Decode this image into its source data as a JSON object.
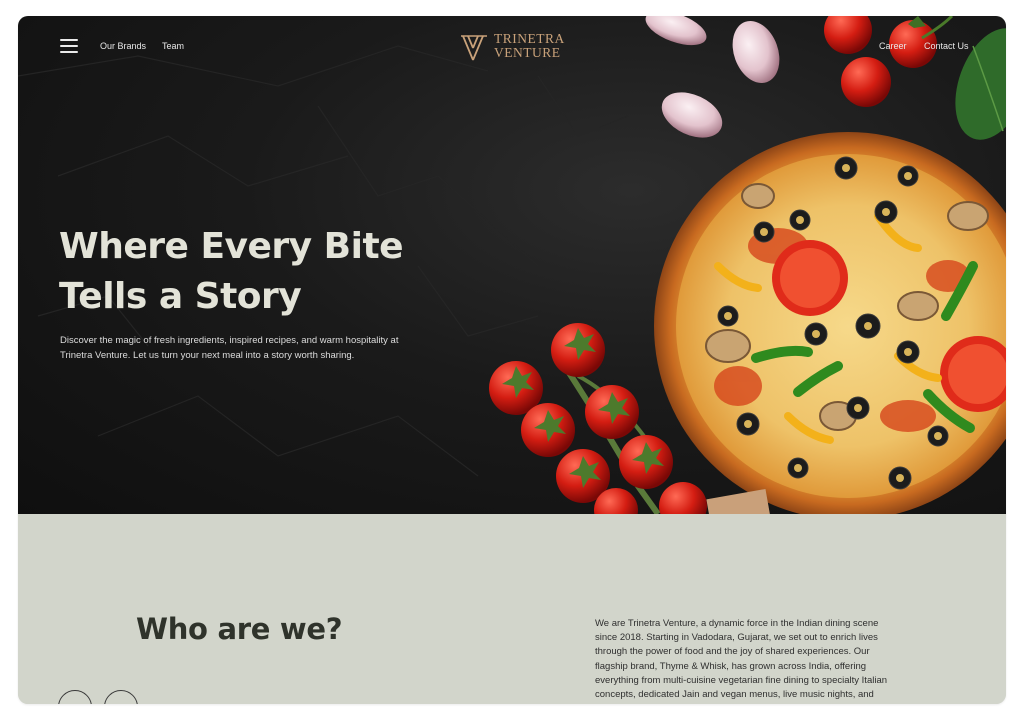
{
  "nav": {
    "menu_icon": "hamburger-menu-icon",
    "links_left": [
      "Our Brands",
      "Team"
    ],
    "links_right": [
      "Career",
      "Contact Us"
    ],
    "logo": {
      "line1": "TRINETRA",
      "line2": "VENTURE",
      "mark": "trinetra-logo-mark"
    }
  },
  "hero": {
    "headline_line1": "Where Every Bite",
    "headline_line2": "Tells a Story",
    "tagline": "Discover the magic of fresh ingredients, inspired recipes, and warm hospitality at Trinetra Venture. Let us turn your next meal into a story worth sharing.",
    "image": "pizza-with-tomatoes-garlic-basil"
  },
  "about": {
    "title": "Who are we?",
    "text": "We are Trinetra Venture, a dynamic force in the Indian dining scene since 2018. Starting in Vadodara, Gujarat, we set out to enrich lives through the power of food and the joy of shared experiences. Our flagship brand, Thyme & Whisk, has grown across India, offering everything from multi-cuisine vegetarian fine dining to specialty Italian concepts, dedicated Jain and vegan menus, live music nights, and"
  },
  "colors": {
    "hero_bg": "#151515",
    "accent_gold": "#c9a27a",
    "headline": "#e3e3d8",
    "about_bg": "#d2d5cb",
    "about_title": "#2f332b"
  }
}
